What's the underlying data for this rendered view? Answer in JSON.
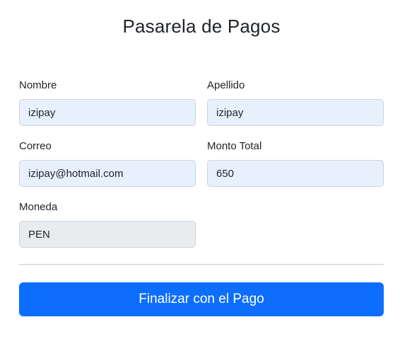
{
  "page": {
    "title": "Pasarela de Pagos"
  },
  "form": {
    "nombre": {
      "label": "Nombre",
      "value": "izipay"
    },
    "apellido": {
      "label": "Apellido",
      "value": "izipay"
    },
    "correo": {
      "label": "Correo",
      "value": "izipay@hotmail.com"
    },
    "monto": {
      "label": "Monto Total",
      "value": "650"
    },
    "moneda": {
      "label": "Moneda",
      "value": "PEN",
      "disabled": true
    }
  },
  "actions": {
    "submit_label": "Finalizar con el Pago"
  },
  "colors": {
    "primary": "#0d6efd",
    "autofill_bg": "#e8f0fe",
    "disabled_bg": "#e9ecef"
  }
}
